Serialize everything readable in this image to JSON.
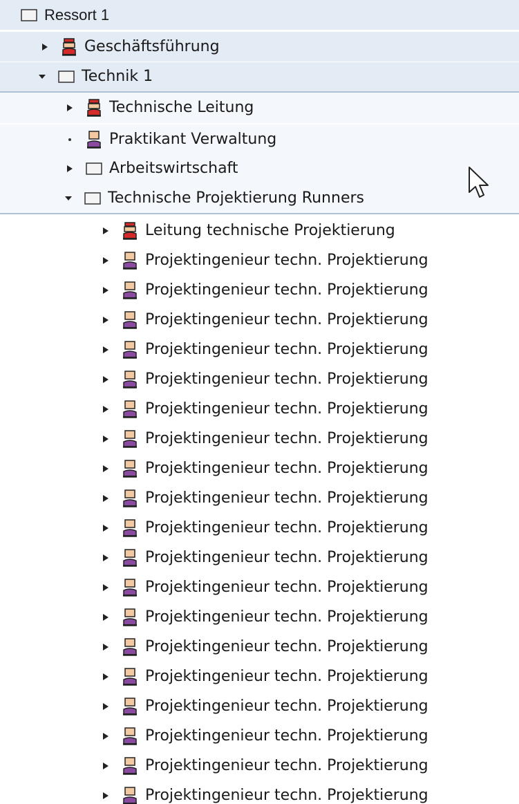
{
  "tree": {
    "root": {
      "label": "Ressort 1",
      "icon": "org-unit-icon",
      "state": "none"
    },
    "level1": [
      {
        "label": "Geschäftsführung",
        "icon": "manager-icon",
        "state": "collapsed"
      },
      {
        "label": "Technik 1",
        "icon": "org-unit-icon",
        "state": "expanded"
      }
    ],
    "level2": [
      {
        "label": "Technische Leitung",
        "icon": "manager-icon",
        "state": "collapsed"
      },
      {
        "label": "Praktikant Verwaltung",
        "icon": "person-icon",
        "state": "leaf"
      },
      {
        "label": "Arbeitswirtschaft",
        "icon": "org-unit-icon",
        "state": "collapsed"
      },
      {
        "label": "Technische Projektierung Runners",
        "icon": "org-unit-icon",
        "state": "expanded"
      }
    ],
    "level3": [
      {
        "label": "Leitung technische Projektierung",
        "icon": "manager-icon",
        "state": "collapsed"
      },
      {
        "label": "Projektingenieur techn. Projektierung",
        "icon": "person-icon",
        "state": "collapsed"
      },
      {
        "label": "Projektingenieur techn. Projektierung",
        "icon": "person-icon",
        "state": "collapsed"
      },
      {
        "label": "Projektingenieur techn. Projektierung",
        "icon": "person-icon",
        "state": "collapsed"
      },
      {
        "label": "Projektingenieur techn. Projektierung",
        "icon": "person-icon",
        "state": "collapsed"
      },
      {
        "label": "Projektingenieur techn. Projektierung",
        "icon": "person-icon",
        "state": "collapsed"
      },
      {
        "label": "Projektingenieur techn. Projektierung",
        "icon": "person-icon",
        "state": "collapsed"
      },
      {
        "label": "Projektingenieur techn. Projektierung",
        "icon": "person-icon",
        "state": "collapsed"
      },
      {
        "label": "Projektingenieur techn. Projektierung",
        "icon": "person-icon",
        "state": "collapsed"
      },
      {
        "label": "Projektingenieur techn. Projektierung",
        "icon": "person-icon",
        "state": "collapsed"
      },
      {
        "label": "Projektingenieur techn. Projektierung",
        "icon": "person-icon",
        "state": "collapsed"
      },
      {
        "label": "Projektingenieur techn. Projektierung",
        "icon": "person-icon",
        "state": "collapsed"
      },
      {
        "label": "Projektingenieur techn. Projektierung",
        "icon": "person-icon",
        "state": "collapsed"
      },
      {
        "label": "Projektingenieur techn. Projektierung",
        "icon": "person-icon",
        "state": "collapsed"
      },
      {
        "label": "Projektingenieur techn. Projektierung",
        "icon": "person-icon",
        "state": "collapsed"
      },
      {
        "label": "Projektingenieur techn. Projektierung",
        "icon": "person-icon",
        "state": "collapsed"
      },
      {
        "label": "Projektingenieur techn. Projektierung",
        "icon": "person-icon",
        "state": "collapsed"
      },
      {
        "label": "Projektingenieur techn. Projektierung",
        "icon": "person-icon",
        "state": "collapsed"
      },
      {
        "label": "Projektingenieur techn. Projektierung",
        "icon": "person-icon",
        "state": "collapsed"
      },
      {
        "label": "Projektingenieur techn. Projektierung",
        "icon": "person-icon",
        "state": "collapsed"
      }
    ]
  },
  "colors": {
    "band": "#e3ebf5",
    "band_border": "#aebfd6",
    "manager_icon": "#d42a2a",
    "person_icon": "#8a4aa0",
    "org_unit_icon": "#f4f4f4"
  }
}
